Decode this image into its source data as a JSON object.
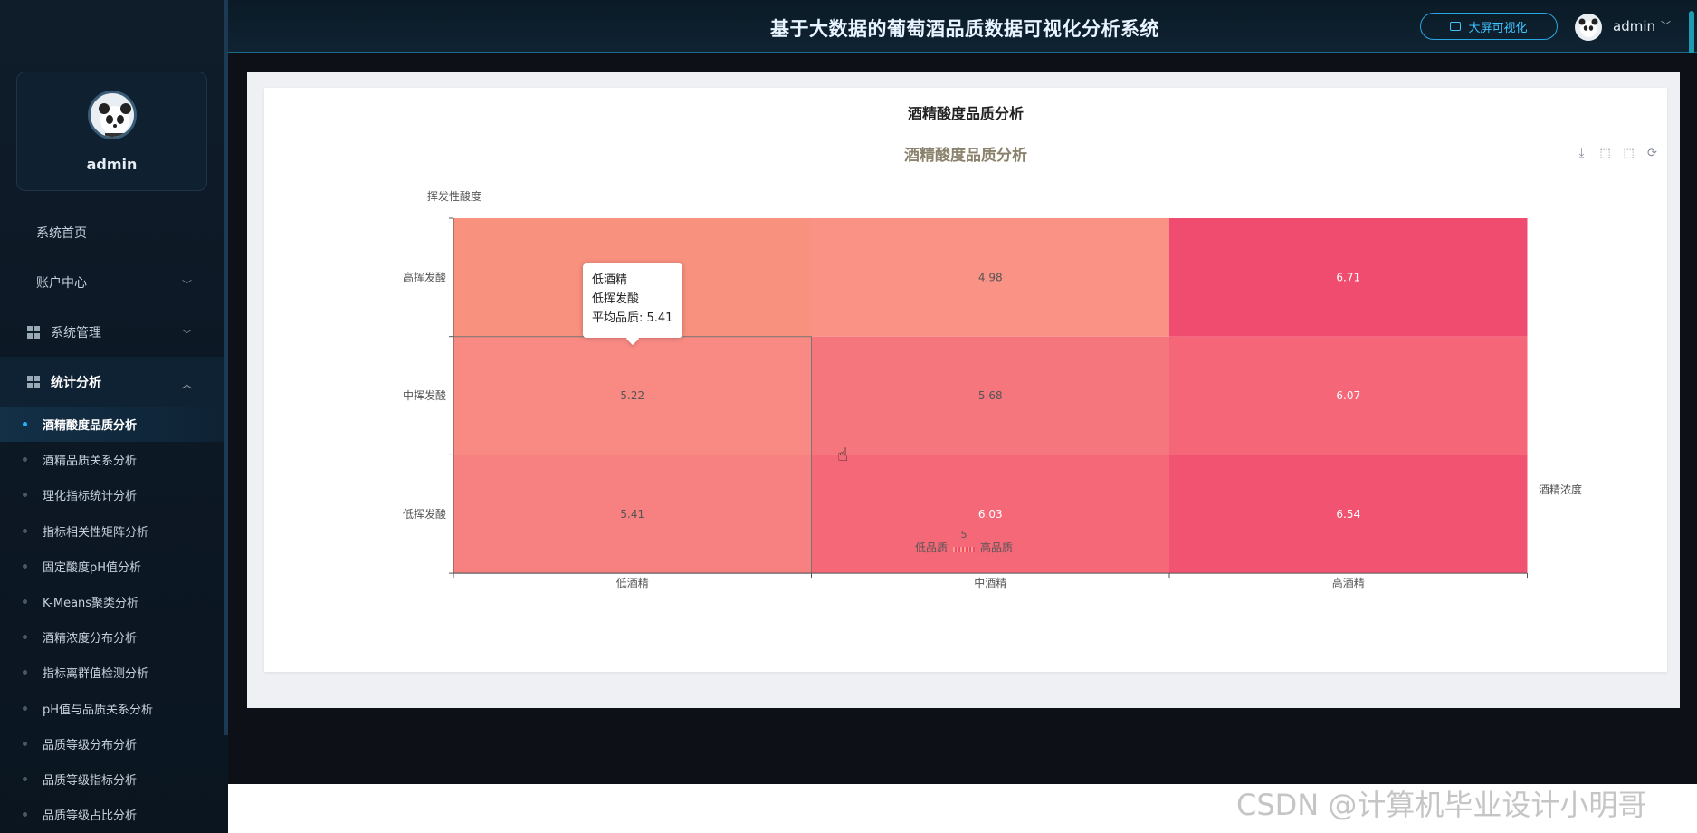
{
  "app": {
    "title": "基于大数据的葡萄酒品质数据可视化分析系统",
    "bigscreen_label": "大屏可视化",
    "user": "admin"
  },
  "sidebar": {
    "profile_name": "admin",
    "items": [
      {
        "label": "系统首页"
      },
      {
        "label": "账户中心"
      },
      {
        "label": "系统管理"
      },
      {
        "label": "统计分析"
      }
    ],
    "sub_items": [
      {
        "label": "酒精酸度品质分析"
      },
      {
        "label": "酒精品质关系分析"
      },
      {
        "label": "理化指标统计分析"
      },
      {
        "label": "指标相关性矩阵分析"
      },
      {
        "label": "固定酸度pH值分析"
      },
      {
        "label": "K-Means聚类分析"
      },
      {
        "label": "酒精浓度分布分析"
      },
      {
        "label": "指标离群值检测分析"
      },
      {
        "label": "pH值与品质关系分析"
      },
      {
        "label": "品质等级分布分析"
      },
      {
        "label": "品质等级指标分析"
      },
      {
        "label": "品质等级占比分析"
      }
    ]
  },
  "card": {
    "title": "酒精酸度品质分析"
  },
  "chart_data": {
    "type": "heatmap",
    "title": "酒精酸度品质分析",
    "xlabel": "酒精浓度",
    "ylabel": "挥发性酸度",
    "x_categories": [
      "低酒精",
      "中酒精",
      "高酒精"
    ],
    "y_categories": [
      "高挥发酸",
      "中挥发酸",
      "低挥发酸"
    ],
    "values": [
      [
        null,
        4.98,
        6.71
      ],
      [
        5.22,
        5.68,
        6.07
      ],
      [
        5.41,
        6.03,
        6.54
      ]
    ],
    "visual_map": {
      "min_label": "低品质",
      "max_label": "高品质",
      "value_label": "5",
      "colors": [
        "#f9a08a",
        "#f04a6e"
      ]
    }
  },
  "tooltip": {
    "line1": "低酒精",
    "line2": "低挥发酸",
    "line3": "平均品质: 5.41"
  },
  "watermark": "CSDN @计算机毕业设计小明哥"
}
